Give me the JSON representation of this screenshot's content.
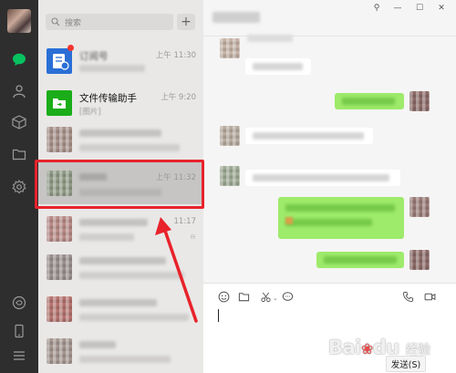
{
  "search": {
    "placeholder": "搜索"
  },
  "add_button_label": "+",
  "sessions": [
    {
      "name": "订阅号",
      "time": "上午 11:30",
      "message": ""
    },
    {
      "name": "文件传输助手",
      "time": "上午 9:20",
      "message": "[图片]"
    },
    {
      "name": "",
      "time": "",
      "message": ""
    },
    {
      "name": "",
      "time": "上午 11:32",
      "message": ""
    },
    {
      "name": "",
      "time": "11:17",
      "message": ""
    },
    {
      "name": "",
      "time": "",
      "message": ""
    },
    {
      "name": "",
      "time": "",
      "message": ""
    },
    {
      "name": "",
      "time": "",
      "message": ""
    }
  ],
  "window_controls": {
    "pin": "⚲",
    "minimize": "—",
    "maximize": "☐",
    "close": "✕"
  },
  "composer": {
    "send_label": "发送(S)"
  },
  "watermark": {
    "main": "Bai",
    "du": "du",
    "sub": "经验"
  },
  "colors": {
    "rail": "#2e2e2e",
    "accent_green": "#07c160",
    "outgoing_bubble": "#9eea6a",
    "highlight": "#e8222b"
  },
  "icons": [
    "chat-icon",
    "contacts-icon",
    "box-icon",
    "folder-icon",
    "gear-icon",
    "miniprogram-icon",
    "phone-icon",
    "menu-icon",
    "emoji-icon",
    "file-icon",
    "scissors-icon",
    "bubble-icon",
    "call-icon",
    "video-icon",
    "search-icon"
  ]
}
